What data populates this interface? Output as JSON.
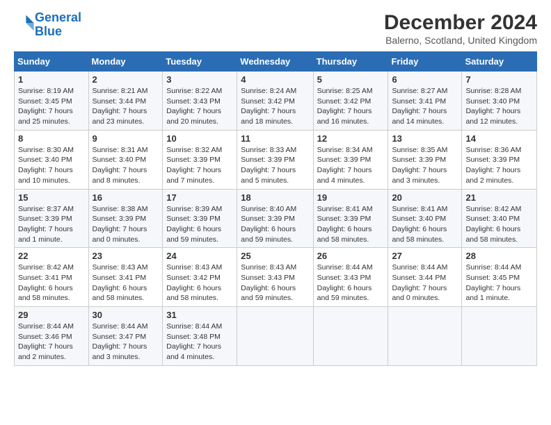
{
  "header": {
    "logo_line1": "General",
    "logo_line2": "Blue",
    "month_title": "December 2024",
    "subtitle": "Balerno, Scotland, United Kingdom"
  },
  "days_of_week": [
    "Sunday",
    "Monday",
    "Tuesday",
    "Wednesday",
    "Thursday",
    "Friday",
    "Saturday"
  ],
  "weeks": [
    [
      {
        "day": "1",
        "text": "Sunrise: 8:19 AM\nSunset: 3:45 PM\nDaylight: 7 hours and 25 minutes."
      },
      {
        "day": "2",
        "text": "Sunrise: 8:21 AM\nSunset: 3:44 PM\nDaylight: 7 hours and 23 minutes."
      },
      {
        "day": "3",
        "text": "Sunrise: 8:22 AM\nSunset: 3:43 PM\nDaylight: 7 hours and 20 minutes."
      },
      {
        "day": "4",
        "text": "Sunrise: 8:24 AM\nSunset: 3:42 PM\nDaylight: 7 hours and 18 minutes."
      },
      {
        "day": "5",
        "text": "Sunrise: 8:25 AM\nSunset: 3:42 PM\nDaylight: 7 hours and 16 minutes."
      },
      {
        "day": "6",
        "text": "Sunrise: 8:27 AM\nSunset: 3:41 PM\nDaylight: 7 hours and 14 minutes."
      },
      {
        "day": "7",
        "text": "Sunrise: 8:28 AM\nSunset: 3:40 PM\nDaylight: 7 hours and 12 minutes."
      }
    ],
    [
      {
        "day": "8",
        "text": "Sunrise: 8:30 AM\nSunset: 3:40 PM\nDaylight: 7 hours and 10 minutes."
      },
      {
        "day": "9",
        "text": "Sunrise: 8:31 AM\nSunset: 3:40 PM\nDaylight: 7 hours and 8 minutes."
      },
      {
        "day": "10",
        "text": "Sunrise: 8:32 AM\nSunset: 3:39 PM\nDaylight: 7 hours and 7 minutes."
      },
      {
        "day": "11",
        "text": "Sunrise: 8:33 AM\nSunset: 3:39 PM\nDaylight: 7 hours and 5 minutes."
      },
      {
        "day": "12",
        "text": "Sunrise: 8:34 AM\nSunset: 3:39 PM\nDaylight: 7 hours and 4 minutes."
      },
      {
        "day": "13",
        "text": "Sunrise: 8:35 AM\nSunset: 3:39 PM\nDaylight: 7 hours and 3 minutes."
      },
      {
        "day": "14",
        "text": "Sunrise: 8:36 AM\nSunset: 3:39 PM\nDaylight: 7 hours and 2 minutes."
      }
    ],
    [
      {
        "day": "15",
        "text": "Sunrise: 8:37 AM\nSunset: 3:39 PM\nDaylight: 7 hours and 1 minute."
      },
      {
        "day": "16",
        "text": "Sunrise: 8:38 AM\nSunset: 3:39 PM\nDaylight: 7 hours and 0 minutes."
      },
      {
        "day": "17",
        "text": "Sunrise: 8:39 AM\nSunset: 3:39 PM\nDaylight: 6 hours and 59 minutes."
      },
      {
        "day": "18",
        "text": "Sunrise: 8:40 AM\nSunset: 3:39 PM\nDaylight: 6 hours and 59 minutes."
      },
      {
        "day": "19",
        "text": "Sunrise: 8:41 AM\nSunset: 3:39 PM\nDaylight: 6 hours and 58 minutes."
      },
      {
        "day": "20",
        "text": "Sunrise: 8:41 AM\nSunset: 3:40 PM\nDaylight: 6 hours and 58 minutes."
      },
      {
        "day": "21",
        "text": "Sunrise: 8:42 AM\nSunset: 3:40 PM\nDaylight: 6 hours and 58 minutes."
      }
    ],
    [
      {
        "day": "22",
        "text": "Sunrise: 8:42 AM\nSunset: 3:41 PM\nDaylight: 6 hours and 58 minutes."
      },
      {
        "day": "23",
        "text": "Sunrise: 8:43 AM\nSunset: 3:41 PM\nDaylight: 6 hours and 58 minutes."
      },
      {
        "day": "24",
        "text": "Sunrise: 8:43 AM\nSunset: 3:42 PM\nDaylight: 6 hours and 58 minutes."
      },
      {
        "day": "25",
        "text": "Sunrise: 8:43 AM\nSunset: 3:43 PM\nDaylight: 6 hours and 59 minutes."
      },
      {
        "day": "26",
        "text": "Sunrise: 8:44 AM\nSunset: 3:43 PM\nDaylight: 6 hours and 59 minutes."
      },
      {
        "day": "27",
        "text": "Sunrise: 8:44 AM\nSunset: 3:44 PM\nDaylight: 7 hours and 0 minutes."
      },
      {
        "day": "28",
        "text": "Sunrise: 8:44 AM\nSunset: 3:45 PM\nDaylight: 7 hours and 1 minute."
      }
    ],
    [
      {
        "day": "29",
        "text": "Sunrise: 8:44 AM\nSunset: 3:46 PM\nDaylight: 7 hours and 2 minutes."
      },
      {
        "day": "30",
        "text": "Sunrise: 8:44 AM\nSunset: 3:47 PM\nDaylight: 7 hours and 3 minutes."
      },
      {
        "day": "31",
        "text": "Sunrise: 8:44 AM\nSunset: 3:48 PM\nDaylight: 7 hours and 4 minutes."
      },
      {
        "day": "",
        "text": ""
      },
      {
        "day": "",
        "text": ""
      },
      {
        "day": "",
        "text": ""
      },
      {
        "day": "",
        "text": ""
      }
    ]
  ]
}
